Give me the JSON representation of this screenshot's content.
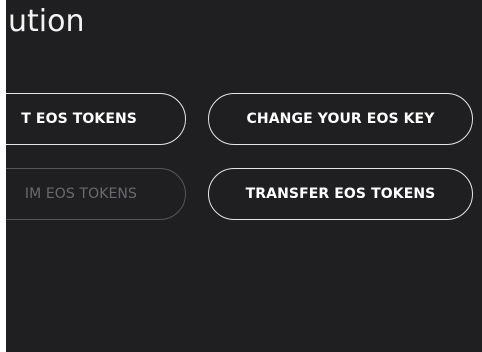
{
  "page": {
    "title": "ution"
  },
  "actions": {
    "get_tokens": "T EOS TOKENS",
    "claim_tokens": "IM EOS TOKENS",
    "change_key": "CHANGE YOUR EOS KEY",
    "transfer_tokens": "TRANSFER EOS TOKENS"
  },
  "colors": {
    "panel_background": "#1f1f21",
    "button_border": "#e6e6e6",
    "button_text": "#ffffff",
    "disabled_border": "#56565a",
    "disabled_text": "#6a6a6e"
  }
}
